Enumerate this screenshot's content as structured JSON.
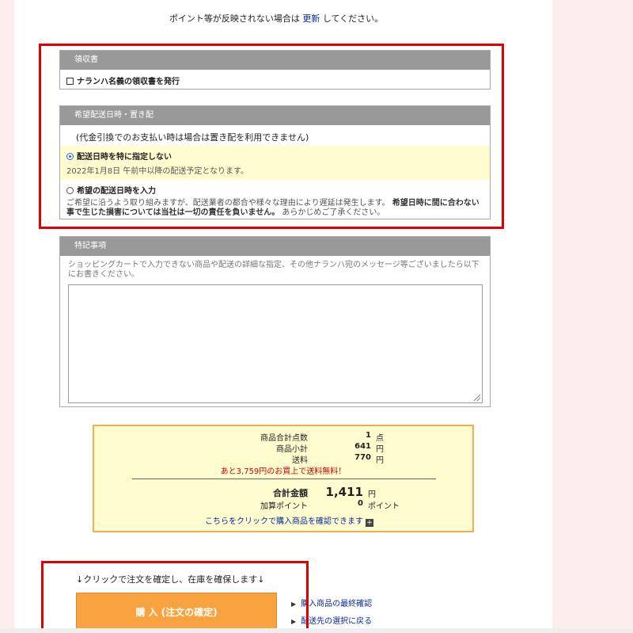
{
  "notice": {
    "prefix": "ポイント等が反映されない場合は ",
    "link": "更新",
    "suffix": " してください。"
  },
  "receipt": {
    "header": "領収書",
    "checkbox_label": "ナランハ名義の領収書を発行"
  },
  "delivery": {
    "header": "希望配送日時・置き配",
    "cod_note": "(代金引換でのお支払い時は場合は置き配を利用できません)",
    "option1_label": "配送日時を特に指定しない",
    "option1_desc": "2022年1月8日 午前中以降の配送予定となります。",
    "option2_label": "希望の配送日時を入力",
    "option2_desc_plain": "ご希望に沿うよう取り組みますが、配送業者の都合や様々な理由により遅延は発生します。",
    "option2_desc_bold": "希望日時に間に合わない事で生じた損害については当社は一切の責任を負いません。",
    "option2_desc_tail": "あらかじめご了承ください。"
  },
  "remarks": {
    "header": "特記事項",
    "instruction": "ショッピングカートで入力できない商品や配送の詳細な指定、その他ナランハ宛のメッセージ等ございましたら以下にお書きください。"
  },
  "summary": {
    "item_count_label": "商品合計点数",
    "item_count_value": "1",
    "item_count_unit": "点",
    "subtotal_label": "商品小計",
    "subtotal_value": "641",
    "subtotal_unit": "円",
    "shipping_label": "送料",
    "shipping_value": "770",
    "shipping_unit": "円",
    "free_shipping_note": "あと3,759円のお買上で送料無料！",
    "total_label": "合計金額",
    "total_value": "1,411",
    "total_unit": "円",
    "points_label": "加算ポイント",
    "points_value": "0",
    "points_unit": "ポイント",
    "confirm_link": "こちらをクリックで購入商品を確認できます"
  },
  "purchase": {
    "instruction": "↓クリックで注文を確定し、在庫を確保します↓",
    "button_label": "購 入 (注文の確定)",
    "link_final_check": "購入商品の最終確認",
    "link_back": "配送先の選択に戻る"
  },
  "colors": {
    "highlight_red": "#e00000",
    "panel_header": "#999999",
    "button_orange": "#f9a340",
    "link_blue": "#0a2a9a"
  }
}
